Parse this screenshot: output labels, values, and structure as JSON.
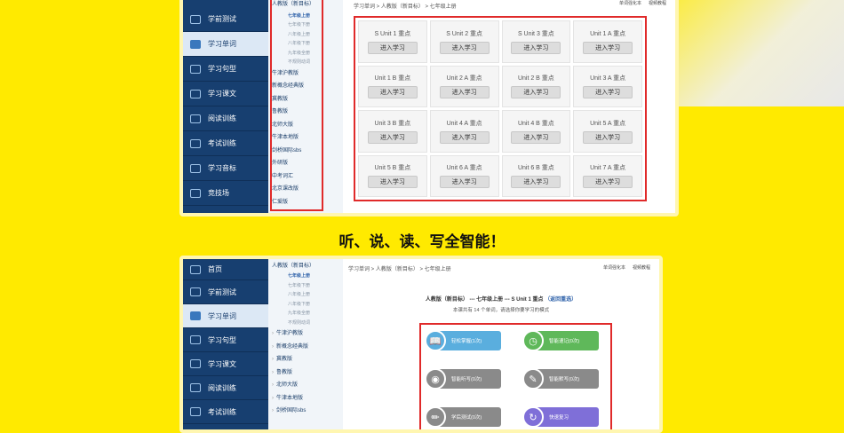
{
  "headline": "听、说、读、写全智能！",
  "top_nav": {
    "items": [
      {
        "label": "学前测试"
      },
      {
        "label": "学习单词"
      },
      {
        "label": "学习句型"
      },
      {
        "label": "学习课文"
      },
      {
        "label": "阅读训练"
      },
      {
        "label": "考试训练"
      },
      {
        "label": "学习音标"
      },
      {
        "label": "竞技场"
      }
    ]
  },
  "top_tree": {
    "root": "人教版（新目标）",
    "subs": [
      "七年级上册",
      "七年级下册",
      "八年级上册",
      "八年级下册",
      "九年级全册",
      "不规则动词"
    ],
    "items": [
      "牛津沪教版",
      "新概念经典版",
      "冀教版",
      "鲁教版",
      "北师大版",
      "牛津本地版",
      "剑桥国际sbs",
      "外研版",
      "中考词汇",
      "北京课改版",
      "仁爱版"
    ]
  },
  "top_content": {
    "crumb": "学习单词 > 人教版（新目标） > 七年级上册",
    "links": [
      "单词强化本",
      "视频教程"
    ],
    "cards": [
      {
        "name": "S Unit 1 重点"
      },
      {
        "name": "S Unit 2 重点"
      },
      {
        "name": "S Unit 3 重点"
      },
      {
        "name": "Unit 1 A 重点"
      },
      {
        "name": "Unit 1 B 重点"
      },
      {
        "name": "Unit 2 A 重点"
      },
      {
        "name": "Unit 2 B 重点"
      },
      {
        "name": "Unit 3 A 重点"
      },
      {
        "name": "Unit 3 B 重点"
      },
      {
        "name": "Unit 4 A 重点"
      },
      {
        "name": "Unit 4 B 重点"
      },
      {
        "name": "Unit 5 A 重点"
      },
      {
        "name": "Unit 5 B 重点"
      },
      {
        "name": "Unit 6 A 重点"
      },
      {
        "name": "Unit 6 B 重点"
      },
      {
        "name": "Unit 7 A 重点"
      }
    ],
    "card_button": "进入学习"
  },
  "bottom_nav": {
    "items": [
      {
        "label": "首页"
      },
      {
        "label": "学前测试"
      },
      {
        "label": "学习单词"
      },
      {
        "label": "学习句型"
      },
      {
        "label": "学习课文"
      },
      {
        "label": "阅读训练"
      },
      {
        "label": "考试训练"
      }
    ]
  },
  "bottom_tree": {
    "root": "人教版（新目标）",
    "subs": [
      "七年级上册",
      "七年级下册",
      "八年级上册",
      "八年级下册",
      "九年级全册",
      "不规则动词"
    ],
    "items": [
      "牛津沪教版",
      "新概念经典版",
      "冀教版",
      "鲁教版",
      "北师大版",
      "牛津本地版",
      "剑桥国际sbs"
    ]
  },
  "bottom_content": {
    "crumb": "学习单词 > 人教版（新目标） > 七年级上册",
    "links": [
      "单词强化本",
      "视频教程"
    ],
    "lesson_title": "人教版（新目标） --- 七年级上册 --- S Unit 1 重点",
    "return_link": "（返回重选）",
    "count_text": "本课共有 14 个单词，请选择你要学习的模式",
    "modes": [
      {
        "label": "轻松掌握(1次)",
        "icon": "book-icon",
        "color": "#5aaede"
      },
      {
        "label": "智能速记(0次)",
        "icon": "clock-icon",
        "color": "#5fb85a"
      },
      {
        "label": "智能听写(0次)",
        "icon": "headphones-icon",
        "color": "#8a8a8a"
      },
      {
        "label": "智能默写(0次)",
        "icon": "edit-icon",
        "color": "#8a8a8a"
      },
      {
        "label": "学后测试(0次)",
        "icon": "pen-icon",
        "color": "#8a8a8a"
      },
      {
        "label": "快速复习",
        "icon": "refresh-icon",
        "color": "#7f6fd8"
      }
    ]
  }
}
